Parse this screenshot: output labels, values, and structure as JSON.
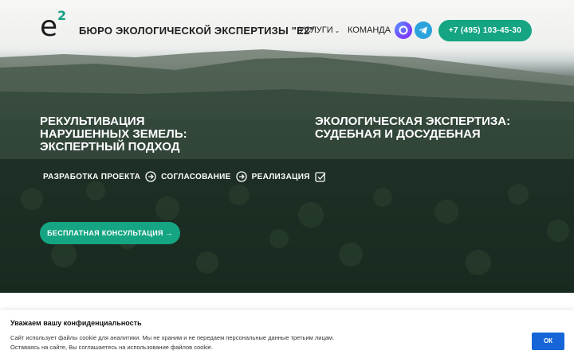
{
  "header": {
    "logo_letter": "e",
    "logo_superscript": "2",
    "brand_name": "БЮРО ЭКОЛОГИЧЕСКОЙ ЭКСПЕРТИЗЫ \"E2\"",
    "nav": {
      "services_label": "УСЛУГИ",
      "team_label": "КОМАНДА"
    },
    "social_icons": [
      "max-messenger-icon",
      "telegram-icon"
    ],
    "phone_label": "+7 (495) 103-45-30"
  },
  "hero": {
    "left_heading_lines": [
      "РЕКУЛЬТИВАЦИЯ",
      "НАРУШЕННЫХ ЗЕМЕЛЬ:",
      "ЭКСПЕРТНЫЙ ПОДХОД"
    ],
    "right_heading_lines": [
      "ЭКОЛОГИЧЕСКАЯ ЭКСПЕРТИЗА:",
      "СУДЕБНАЯ И ДОСУДЕБНАЯ"
    ],
    "steps": [
      {
        "label": "РАЗРАБОТКА ПРОЕКТА",
        "icon": "arrow-circle-icon"
      },
      {
        "label": "СОГЛАСОВАНИЕ",
        "icon": "arrow-circle-icon"
      },
      {
        "label": "РЕАЛИЗАЦИЯ",
        "icon": "check-square-icon"
      }
    ],
    "consult_button_label": "БЕСПЛАТНАЯ КОНСУЛЬТАЦИЯ →"
  },
  "cookie_banner": {
    "title": "Уважаем вашу конфиденциальность",
    "text_line1": "Сайт использует файлы cookie для аналитики. Мы не храним и не передаем персональные данные третьим лицам.",
    "text_line2": "Оставаясь на сайте, Вы соглашаетесь на использование файлов cookie.",
    "ok_label": "ОК"
  },
  "colors": {
    "accent": "#15a583",
    "ok_button": "#1565d8"
  }
}
